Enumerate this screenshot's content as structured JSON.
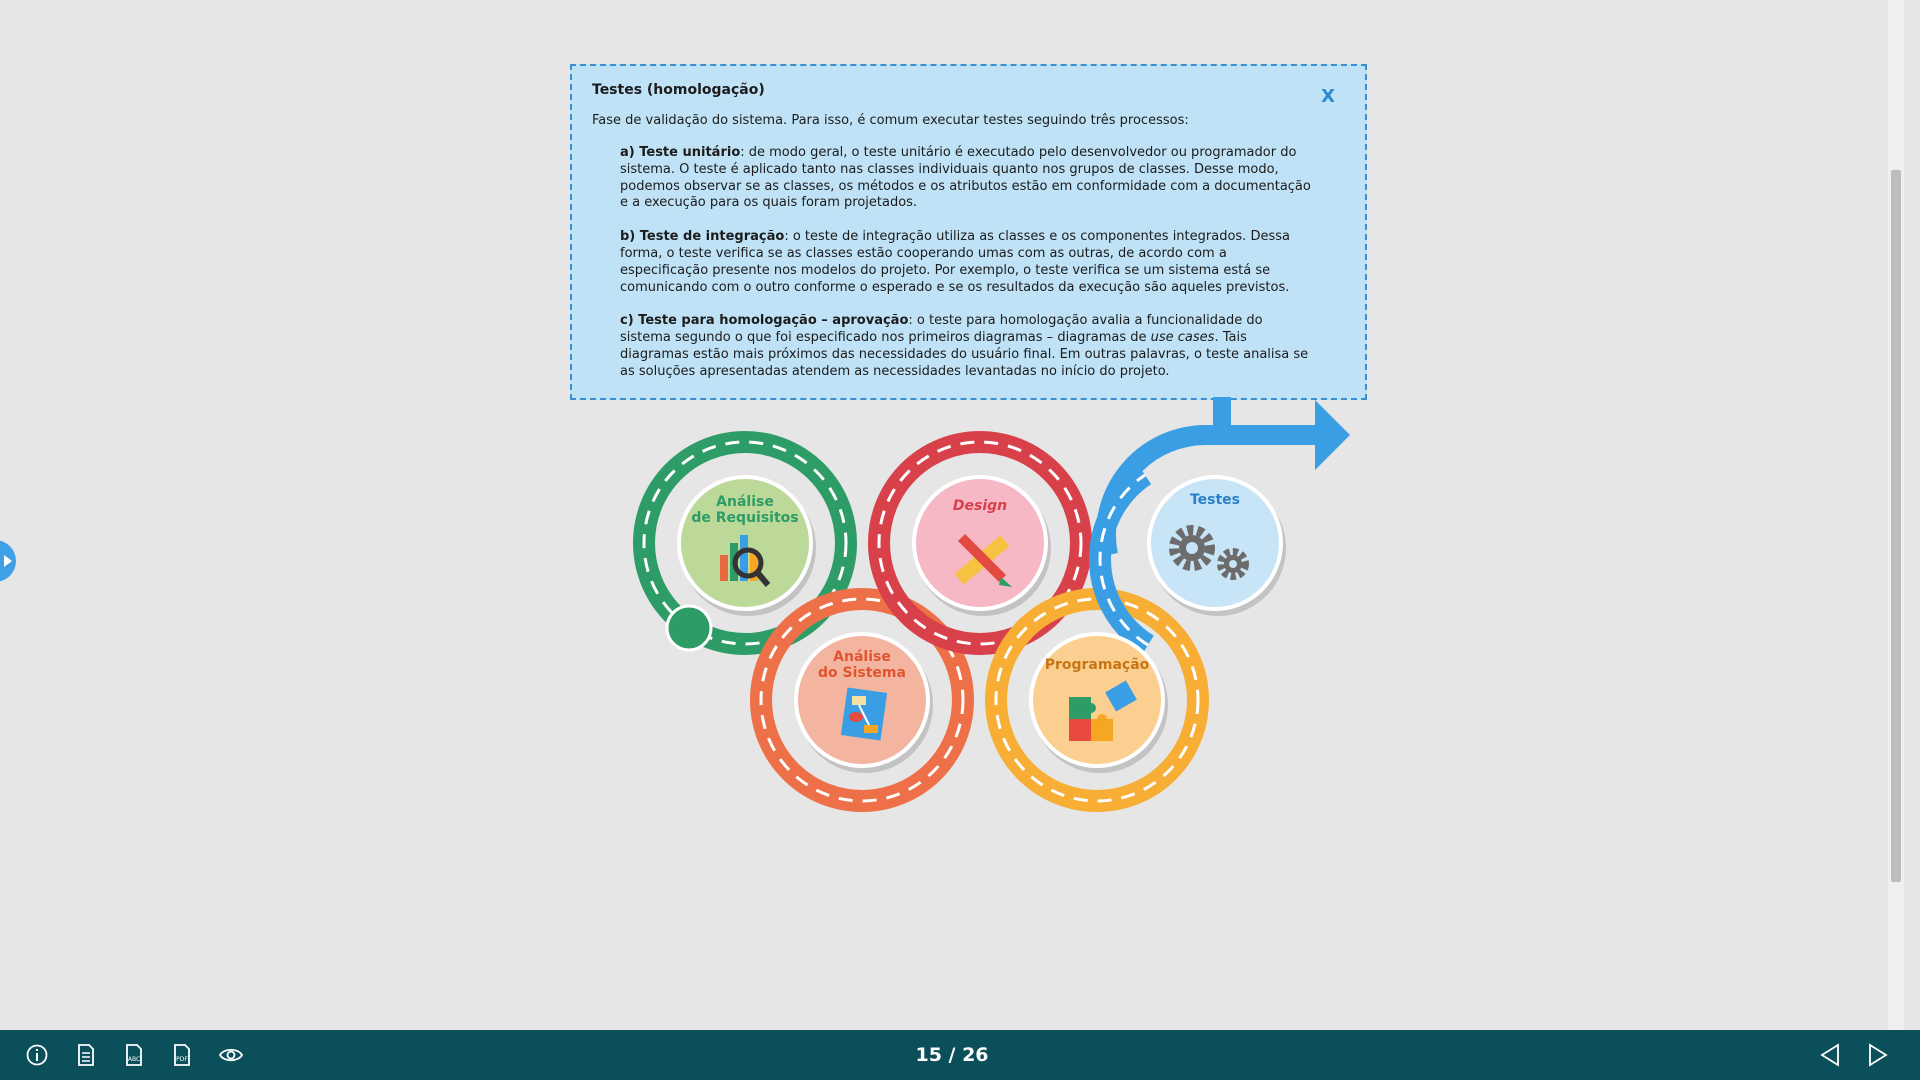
{
  "popup": {
    "title": "Testes (homologação)",
    "close_label": "X",
    "intro": "Fase de validação do sistema. Para isso, é comum executar testes seguindo três processos:",
    "processes": [
      {
        "label": "a) Teste unitário",
        "text": ": de modo geral, o teste unitário é executado pelo desenvolvedor ou programador do sistema. O teste é aplicado tanto nas classes individuais quanto nos grupos de classes. Desse modo, podemos observar se as classes, os métodos e os atributos estão em conformidade com a documentação e a execução para os quais foram projetados."
      },
      {
        "label": "b) Teste de integração",
        "text": ": o teste de integração utiliza as classes e os componentes integrados. Dessa forma, o teste verifica se as classes estão cooperando umas com as outras, de acordo com a especificação presente nos modelos do projeto. Por exemplo, o teste verifica se um sistema está se comunicando com  o outro conforme o esperado e se os resultados da execução são aqueles previstos."
      },
      {
        "label": "c) Teste para homologação – aprovação",
        "text_before": ": o teste para homologação avalia a funcionalidade do sistema segundo o que foi especificado nos primeiros diagramas – diagramas de ",
        "text_italic": "use cases",
        "text_after": ". Tais diagramas estão mais próximos das necessidades do usuário final. Em outras palavras, o teste analisa se as soluções apresentadas atendem as necessidades levantadas no início do projeto."
      }
    ]
  },
  "diagram": {
    "stages": [
      {
        "line1": "Análise",
        "line2": "de Requisitos",
        "icon": "chart-magnifier-icon",
        "color": "#2e9c66"
      },
      {
        "line1": "Análise",
        "line2": "do Sistema",
        "icon": "flowchart-icon",
        "color": "#e8693f"
      },
      {
        "line1": "Design",
        "line2": "",
        "icon": "pencil-ruler-icon",
        "color": "#d8404a"
      },
      {
        "line1": "Programação",
        "line2": "",
        "icon": "puzzle-icon",
        "color": "#f5a623"
      },
      {
        "line1": "Testes",
        "line2": "",
        "icon": "gears-icon",
        "color": "#3a9ee4"
      }
    ]
  },
  "toolbar": {
    "icons": [
      "info-icon",
      "document-icon",
      "glossary-icon",
      "pdf-icon",
      "eye-icon"
    ],
    "page_counter": "15 / 26",
    "prev_icon": "prev-arrow-icon",
    "next_icon": "next-arrow-icon"
  },
  "colors": {
    "popup_bg": "#bfe2f7",
    "popup_border": "#3a8fd0",
    "bottombar": "#0b4f5a",
    "page_bg": "#e6e6e6"
  }
}
